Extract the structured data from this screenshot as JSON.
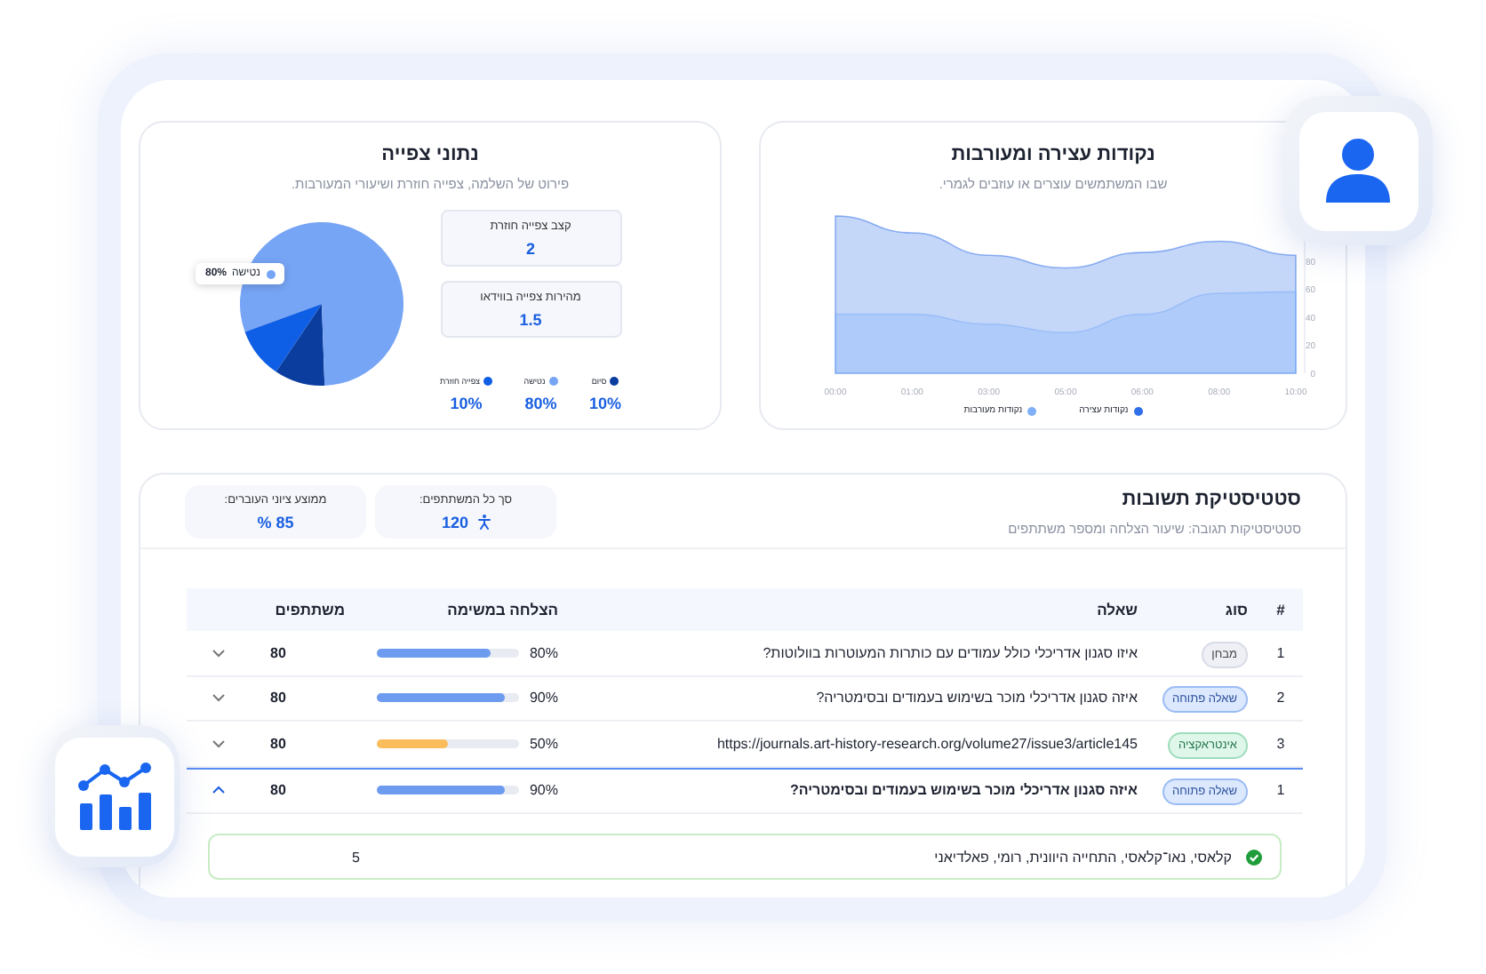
{
  "engagement_card": {
    "title": "נקודות עצירה ומעורבות",
    "subtitle": "שבו המשתמשים עוצרים או עוזבים לגמרי.",
    "chart_data": {
      "type": "area",
      "x": [
        "00:00",
        "01:00",
        "03:00",
        "05:00",
        "06:00",
        "08:00",
        "10:00"
      ],
      "ylim": [
        0,
        120
      ],
      "yticks": [
        0,
        20,
        40,
        60,
        80
      ],
      "series": [
        {
          "name": "נקודות עצירה",
          "color": "#2f6fe8",
          "values": [
            112,
            100,
            84,
            75,
            86,
            94,
            84
          ]
        },
        {
          "name": "נקודות מעורבות",
          "color": "#7fb0f7",
          "values": [
            42,
            42,
            35,
            29,
            42,
            57,
            58
          ]
        }
      ]
    }
  },
  "viewing_card": {
    "title": "נתוני צפייה",
    "subtitle": "פירוט של השלמה, צפייה חוזרת ושיעורי המעורבות.",
    "stats": [
      {
        "label": "קצב צפייה חוזרת",
        "value": "2"
      },
      {
        "label": "מהירות צפייה בווידאו",
        "value": "1.5"
      }
    ],
    "tooltip": {
      "label": "נטישה",
      "value": "80%",
      "color": "#76a5f5"
    },
    "chart_data": {
      "type": "pie",
      "categories": [
        "סיום",
        "נטישה",
        "צפייה חוזרת"
      ],
      "values": [
        10,
        80,
        10
      ]
    },
    "legend": [
      {
        "value": "10%",
        "color": "#0a3d9e"
      },
      {
        "value": "80%",
        "color": "#76a5f5"
      },
      {
        "value": "10%",
        "color": "#0f5ee6"
      }
    ]
  },
  "responses": {
    "title": "סטטיסטיקת תשובות",
    "subtitle": "סטטיסטיקות תגובה: שיעור הצלחה ומספר משתתפים",
    "stats": [
      {
        "label": "סך כל המשתתפים:",
        "value": "120"
      },
      {
        "label": "ממוצע ציוני העוברים:",
        "value": "85 %"
      }
    ],
    "columns": [
      "#",
      "סוג",
      "שאלה",
      "הצלחה במשימה",
      "משתתפים"
    ],
    "rows": [
      {
        "number": "1",
        "type": {
          "label": "מבחן",
          "kind": "exam"
        },
        "question": "איזו סגנון אדריכלי כולל עמודים עם כותרות המעוטרות בוולוטות?",
        "success": "80%",
        "level": 0.8,
        "participants": "80",
        "expanded": false
      },
      {
        "number": "2",
        "type": {
          "label": "שאלה פתוחה",
          "kind": "open"
        },
        "question": "איזה סגנון אדריכלי מוכר בשימוש בעמודים ובסימטריה?",
        "success": "90%",
        "level": 0.9,
        "participants": "80",
        "expanded": false
      },
      {
        "number": "3",
        "type": {
          "label": "אינטראקציה",
          "kind": "interaction"
        },
        "question": "https://journals.art-history-research.org/volume27/issue3/article145",
        "success": "50%",
        "level": 0.5,
        "participants": "80",
        "expanded": false
      },
      {
        "number": "1",
        "type": {
          "label": "שאלה פתוחה",
          "kind": "open"
        },
        "question": "איזה סגנון אדריכלי מוכר בשימוש בעמודים ובסימטריה?",
        "success": "90%",
        "level": 0.9,
        "participants": "80",
        "expanded": true
      }
    ],
    "answers": [
      {
        "text": "קלאסי, נאו־קלאסי, התחייה היוונית, רומי, פאלדיאני",
        "count": "5",
        "correct": true
      }
    ]
  }
}
